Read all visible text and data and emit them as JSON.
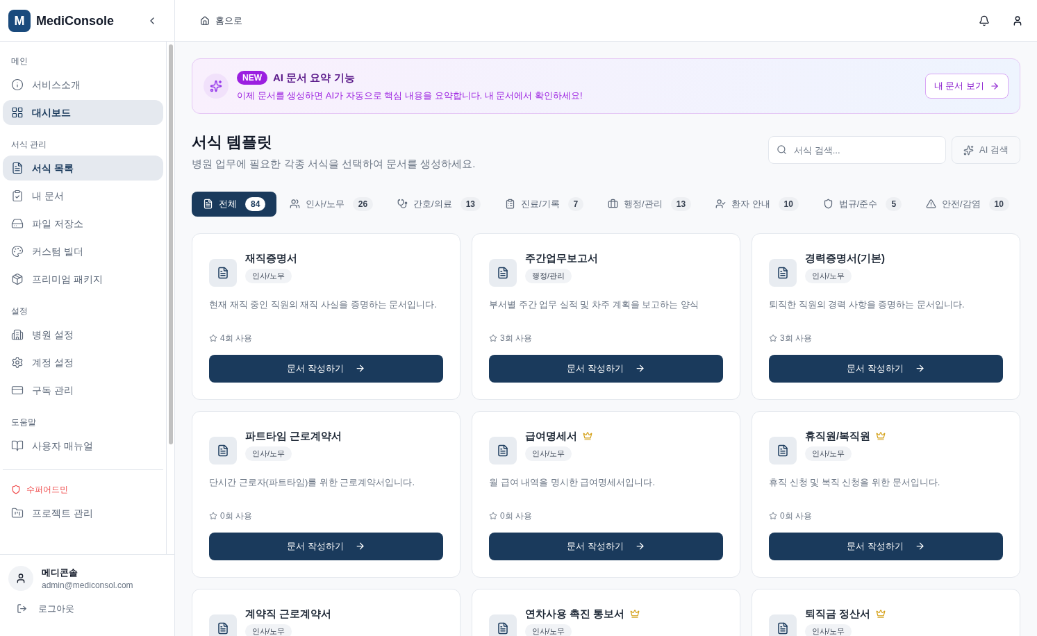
{
  "brand": {
    "logo": "M",
    "name": "MediConsole"
  },
  "sidebar": {
    "sections": [
      {
        "title": "메인",
        "items": [
          {
            "label": "서비스소개",
            "selected": false
          },
          {
            "label": "대시보드",
            "selected": true
          }
        ]
      },
      {
        "title": "서식 관리",
        "items": [
          {
            "label": "서식 목록",
            "selected": true
          },
          {
            "label": "내 문서",
            "selected": false
          },
          {
            "label": "파일 저장소",
            "selected": false
          },
          {
            "label": "커스텀 빌더",
            "selected": false
          },
          {
            "label": "프리미엄 패키지",
            "selected": false
          }
        ]
      },
      {
        "title": "설정",
        "items": [
          {
            "label": "병원 설정",
            "selected": false
          },
          {
            "label": "계정 설정",
            "selected": false
          },
          {
            "label": "구독 관리",
            "selected": false
          }
        ]
      },
      {
        "title": "도움말",
        "items": [
          {
            "label": "사용자 매뉴얼",
            "selected": false
          }
        ]
      }
    ],
    "admin": {
      "title": "수퍼어드민",
      "items": [
        {
          "label": "프로젝트 관리",
          "selected": false
        }
      ]
    },
    "user": {
      "name": "메디콘솔",
      "email": "admin@mediconsol.com"
    },
    "logout": "로그아웃"
  },
  "header": {
    "breadcrumb": "홈으로"
  },
  "banner": {
    "badge": "NEW",
    "title": "AI 문서 요약 기능",
    "text": "이제 문서를 생성하면 AI가 자동으로 핵심 내용을 요약합니다. 내 문서에서 확인하세요!",
    "button": "내 문서 보기"
  },
  "page": {
    "title": "서식 템플릿",
    "subtitle": "병원 업무에 필요한 각종 서식을 선택하여 문서를 생성하세요.",
    "search": {
      "placeholder": "서식 검색..."
    },
    "ai_search": "AI 검색"
  },
  "tabs": [
    {
      "label": "전체",
      "count": "84",
      "selected": true
    },
    {
      "label": "인사/노무",
      "count": "26",
      "selected": false
    },
    {
      "label": "간호/의료",
      "count": "13",
      "selected": false
    },
    {
      "label": "진료/기록",
      "count": "7",
      "selected": false
    },
    {
      "label": "행정/관리",
      "count": "13",
      "selected": false
    },
    {
      "label": "환자 안내",
      "count": "10",
      "selected": false
    },
    {
      "label": "법규/준수",
      "count": "5",
      "selected": false
    },
    {
      "label": "안전/감염",
      "count": "10",
      "selected": false
    }
  ],
  "cards": [
    {
      "title": "재직증명서",
      "category": "인사/노무",
      "description": "현재 재직 중인 직원의 재직 사실을 증명하는 문서입니다.",
      "usage": "4회 사용",
      "premium": false,
      "button": "문서 작성하기"
    },
    {
      "title": "주간업무보고서",
      "category": "행정/관리",
      "description": "부서별 주간 업무 실적 및 차주 계획을 보고하는 양식",
      "usage": "3회 사용",
      "premium": false,
      "button": "문서 작성하기"
    },
    {
      "title": "경력증명서(기본)",
      "category": "인사/노무",
      "description": "퇴직한 직원의 경력 사항을 증명하는 문서입니다.",
      "usage": "3회 사용",
      "premium": false,
      "button": "문서 작성하기"
    },
    {
      "title": "파트타임 근로계약서",
      "category": "인사/노무",
      "description": "단시간 근로자(파트타임)를 위한 근로계약서입니다.",
      "usage": "0회 사용",
      "premium": false,
      "button": "문서 작성하기"
    },
    {
      "title": "급여명세서",
      "category": "인사/노무",
      "description": "월 급여 내역을 명시한 급여명세서입니다.",
      "usage": "0회 사용",
      "premium": true,
      "button": "문서 작성하기"
    },
    {
      "title": "휴직원/복직원",
      "category": "인사/노무",
      "description": "휴직 신청 및 복직 신청을 위한 문서입니다.",
      "usage": "0회 사용",
      "premium": true,
      "button": "문서 작성하기"
    },
    {
      "title": "계약직 근로계약서",
      "category": "인사/노무",
      "premium": false
    },
    {
      "title": "연차사용 촉진 통보서",
      "category": "인사/노무",
      "premium": true
    },
    {
      "title": "퇴직금 정산서",
      "category": "인사/노무",
      "premium": true
    }
  ]
}
